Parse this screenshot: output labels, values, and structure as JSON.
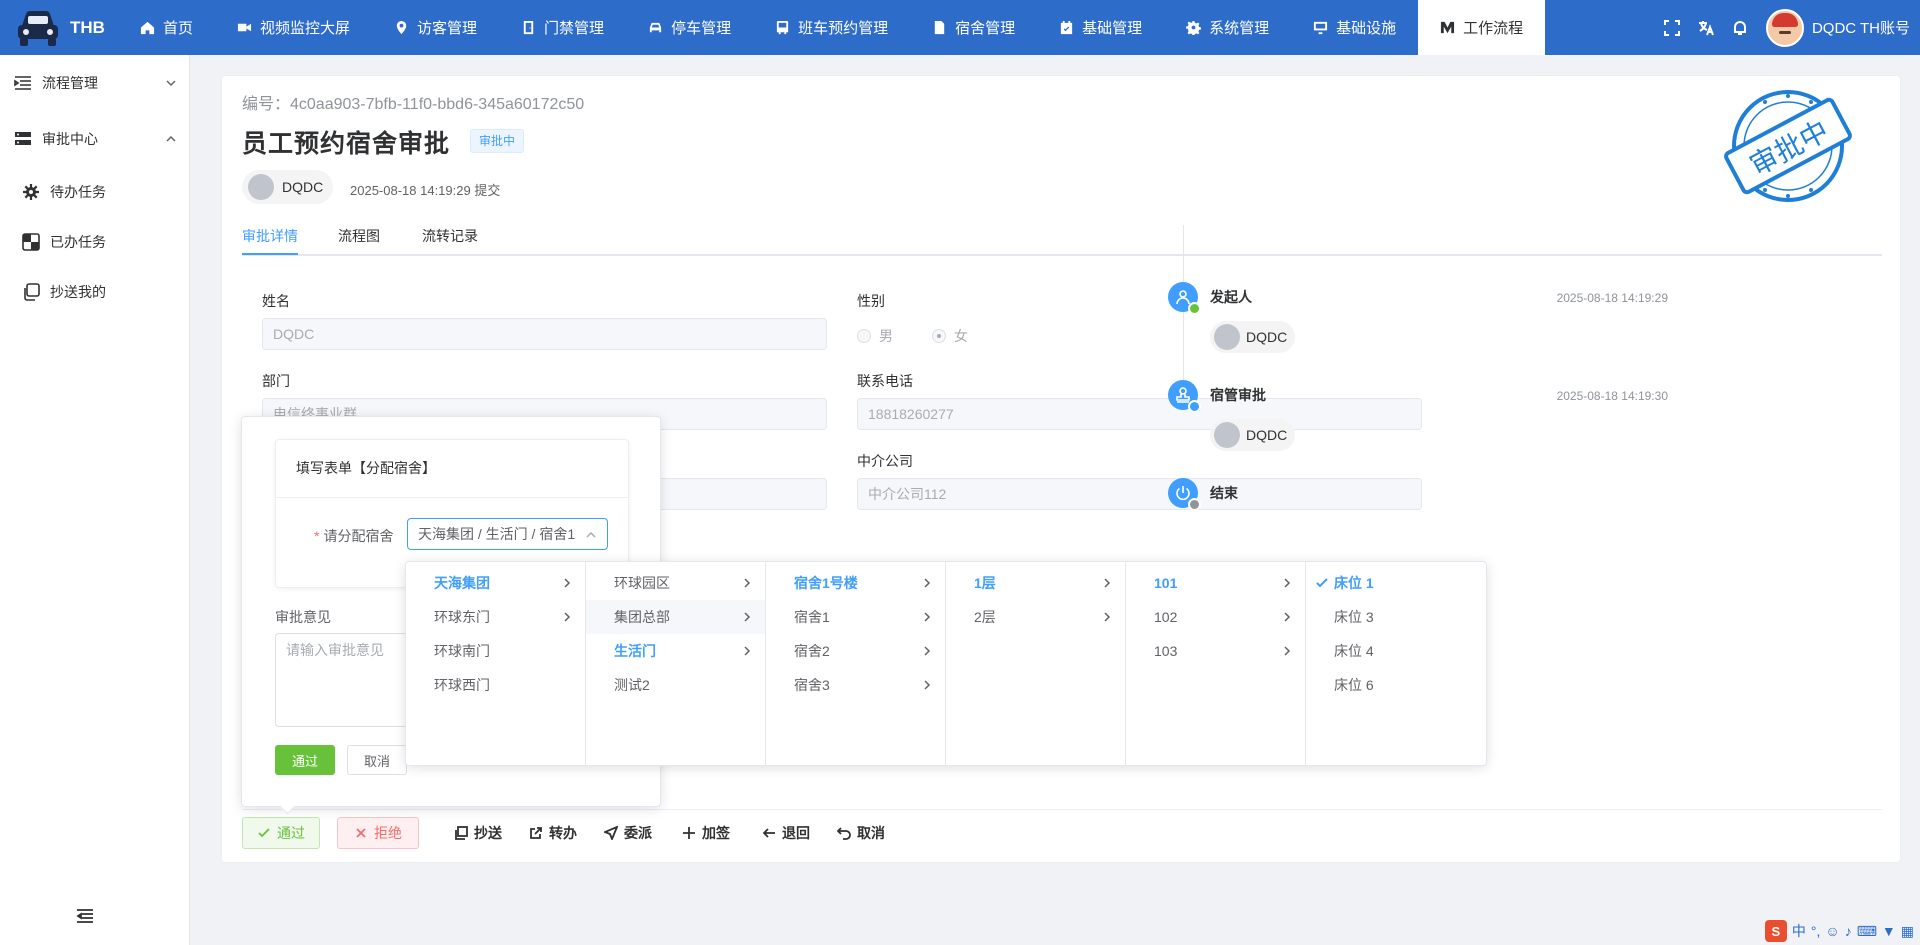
{
  "app": {
    "brand": "THB"
  },
  "nav": {
    "items": [
      {
        "label": "首页",
        "icon": "home-icon"
      },
      {
        "label": "视频监控大屏",
        "icon": "video-icon"
      },
      {
        "label": "访客管理",
        "icon": "location-icon"
      },
      {
        "label": "门禁管理",
        "icon": "door-icon"
      },
      {
        "label": "停车管理",
        "icon": "car-icon"
      },
      {
        "label": "班车预约管理",
        "icon": "bus-icon"
      },
      {
        "label": "宿舍管理",
        "icon": "document-icon"
      },
      {
        "label": "基础管理",
        "icon": "calendar-check-icon"
      },
      {
        "label": "系统管理",
        "icon": "gear-icon"
      },
      {
        "label": "基础设施",
        "icon": "monitor-icon"
      },
      {
        "label": "工作流程",
        "icon": "workflow-icon",
        "active": true
      }
    ]
  },
  "user": {
    "name": "DQDC TH账号"
  },
  "sidebar": {
    "groups": [
      {
        "label": "流程管理",
        "expanded": false
      },
      {
        "label": "审批中心",
        "expanded": true
      }
    ],
    "items": [
      {
        "label": "待办任务"
      },
      {
        "label": "已办任务"
      },
      {
        "label": "抄送我的"
      }
    ]
  },
  "detail": {
    "code": "编号：4c0aa903-7bfb-11f0-bbd6-345a60172c50",
    "title": "员工预约宿舍审批",
    "status": "审批中",
    "stamp_text": "审批中",
    "submitter": "DQDC",
    "submit_time": "2025-08-18 14:19:29 提交"
  },
  "tabs": [
    {
      "label": "审批详情",
      "active": true
    },
    {
      "label": "流程图"
    },
    {
      "label": "流转记录"
    }
  ],
  "form": {
    "name_label": "姓名",
    "name_value": "DQDC",
    "gender_label": "性别",
    "gender_options": [
      "男",
      "女"
    ],
    "gender_selected": "女",
    "dept_label": "部门",
    "dept_value": "电信终事业群",
    "phone_label": "联系电话",
    "phone_value": "18818260277",
    "agency_label": "中介公司",
    "agency_value": "中介公司112"
  },
  "timeline": [
    {
      "title": "发起人",
      "time": "2025-08-18 14:19:29",
      "user": "DQDC",
      "badge_color": "#67c23a"
    },
    {
      "title": "宿管审批",
      "time": "2025-08-18 14:19:30",
      "user": "DQDC",
      "badge_color": "#409eff"
    },
    {
      "title": "结束",
      "time": "",
      "user": "",
      "badge_color": "#909399"
    }
  ],
  "actions": {
    "approve": "通过",
    "reject": "拒绝",
    "tools": [
      "抄送",
      "转办",
      "委派",
      "加签",
      "退回",
      "取消"
    ]
  },
  "popover": {
    "form_title": "填写表单【分配宿舍】",
    "field_label": "请分配宿舍",
    "field_value": "天海集团 / 生活门 / 宿舍1",
    "opinion_label": "审批意见",
    "opinion_placeholder": "请输入审批意见",
    "ok": "通过",
    "cancel": "取消"
  },
  "cascader": {
    "columns": [
      {
        "options": [
          "天海集团",
          "环球东门",
          "环球南门",
          "环球西门"
        ],
        "selected": 0,
        "hover": -1,
        "expand": [
          0,
          1
        ]
      },
      {
        "options": [
          "环球园区",
          "集团总部",
          "生活门",
          "测试2"
        ],
        "selected": 2,
        "hover": 1,
        "expand": [
          0,
          1,
          2
        ]
      },
      {
        "options": [
          "宿舍1号楼",
          "宿舍1",
          "宿舍2",
          "宿舍3"
        ],
        "selected": 0,
        "hover": -1,
        "expand": [
          0,
          1,
          2,
          3
        ]
      },
      {
        "options": [
          "1层",
          "2层"
        ],
        "selected": 0,
        "hover": -1,
        "expand": [
          0,
          1
        ]
      },
      {
        "options": [
          "101",
          "102",
          "103"
        ],
        "selected": 0,
        "hover": -1,
        "expand": [
          0,
          1,
          2
        ]
      },
      {
        "options": [
          "床位 1",
          "床位 3",
          "床位 4",
          "床位 6"
        ],
        "selected": 0,
        "hover": -1,
        "expand": [],
        "check": true
      }
    ]
  },
  "ime": {
    "lang": "中"
  }
}
